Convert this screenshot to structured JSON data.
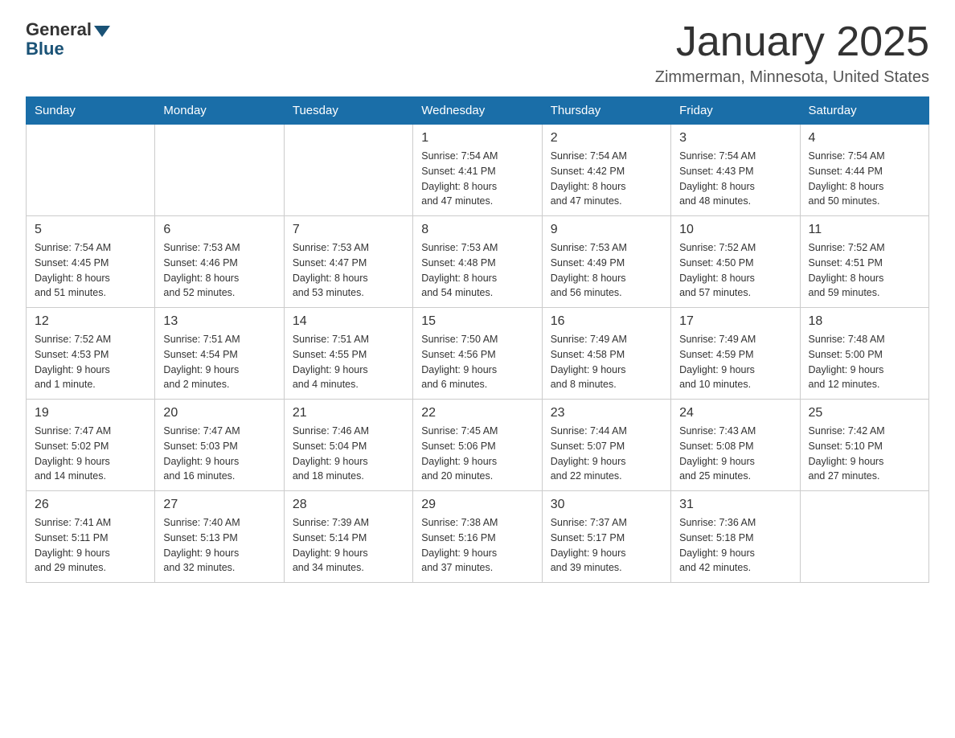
{
  "logo": {
    "text_general": "General",
    "text_blue": "Blue"
  },
  "title": "January 2025",
  "subtitle": "Zimmerman, Minnesota, United States",
  "days_of_week": [
    "Sunday",
    "Monday",
    "Tuesday",
    "Wednesday",
    "Thursday",
    "Friday",
    "Saturday"
  ],
  "weeks": [
    [
      {
        "day": "",
        "info": ""
      },
      {
        "day": "",
        "info": ""
      },
      {
        "day": "",
        "info": ""
      },
      {
        "day": "1",
        "info": "Sunrise: 7:54 AM\nSunset: 4:41 PM\nDaylight: 8 hours\nand 47 minutes."
      },
      {
        "day": "2",
        "info": "Sunrise: 7:54 AM\nSunset: 4:42 PM\nDaylight: 8 hours\nand 47 minutes."
      },
      {
        "day": "3",
        "info": "Sunrise: 7:54 AM\nSunset: 4:43 PM\nDaylight: 8 hours\nand 48 minutes."
      },
      {
        "day": "4",
        "info": "Sunrise: 7:54 AM\nSunset: 4:44 PM\nDaylight: 8 hours\nand 50 minutes."
      }
    ],
    [
      {
        "day": "5",
        "info": "Sunrise: 7:54 AM\nSunset: 4:45 PM\nDaylight: 8 hours\nand 51 minutes."
      },
      {
        "day": "6",
        "info": "Sunrise: 7:53 AM\nSunset: 4:46 PM\nDaylight: 8 hours\nand 52 minutes."
      },
      {
        "day": "7",
        "info": "Sunrise: 7:53 AM\nSunset: 4:47 PM\nDaylight: 8 hours\nand 53 minutes."
      },
      {
        "day": "8",
        "info": "Sunrise: 7:53 AM\nSunset: 4:48 PM\nDaylight: 8 hours\nand 54 minutes."
      },
      {
        "day": "9",
        "info": "Sunrise: 7:53 AM\nSunset: 4:49 PM\nDaylight: 8 hours\nand 56 minutes."
      },
      {
        "day": "10",
        "info": "Sunrise: 7:52 AM\nSunset: 4:50 PM\nDaylight: 8 hours\nand 57 minutes."
      },
      {
        "day": "11",
        "info": "Sunrise: 7:52 AM\nSunset: 4:51 PM\nDaylight: 8 hours\nand 59 minutes."
      }
    ],
    [
      {
        "day": "12",
        "info": "Sunrise: 7:52 AM\nSunset: 4:53 PM\nDaylight: 9 hours\nand 1 minute."
      },
      {
        "day": "13",
        "info": "Sunrise: 7:51 AM\nSunset: 4:54 PM\nDaylight: 9 hours\nand 2 minutes."
      },
      {
        "day": "14",
        "info": "Sunrise: 7:51 AM\nSunset: 4:55 PM\nDaylight: 9 hours\nand 4 minutes."
      },
      {
        "day": "15",
        "info": "Sunrise: 7:50 AM\nSunset: 4:56 PM\nDaylight: 9 hours\nand 6 minutes."
      },
      {
        "day": "16",
        "info": "Sunrise: 7:49 AM\nSunset: 4:58 PM\nDaylight: 9 hours\nand 8 minutes."
      },
      {
        "day": "17",
        "info": "Sunrise: 7:49 AM\nSunset: 4:59 PM\nDaylight: 9 hours\nand 10 minutes."
      },
      {
        "day": "18",
        "info": "Sunrise: 7:48 AM\nSunset: 5:00 PM\nDaylight: 9 hours\nand 12 minutes."
      }
    ],
    [
      {
        "day": "19",
        "info": "Sunrise: 7:47 AM\nSunset: 5:02 PM\nDaylight: 9 hours\nand 14 minutes."
      },
      {
        "day": "20",
        "info": "Sunrise: 7:47 AM\nSunset: 5:03 PM\nDaylight: 9 hours\nand 16 minutes."
      },
      {
        "day": "21",
        "info": "Sunrise: 7:46 AM\nSunset: 5:04 PM\nDaylight: 9 hours\nand 18 minutes."
      },
      {
        "day": "22",
        "info": "Sunrise: 7:45 AM\nSunset: 5:06 PM\nDaylight: 9 hours\nand 20 minutes."
      },
      {
        "day": "23",
        "info": "Sunrise: 7:44 AM\nSunset: 5:07 PM\nDaylight: 9 hours\nand 22 minutes."
      },
      {
        "day": "24",
        "info": "Sunrise: 7:43 AM\nSunset: 5:08 PM\nDaylight: 9 hours\nand 25 minutes."
      },
      {
        "day": "25",
        "info": "Sunrise: 7:42 AM\nSunset: 5:10 PM\nDaylight: 9 hours\nand 27 minutes."
      }
    ],
    [
      {
        "day": "26",
        "info": "Sunrise: 7:41 AM\nSunset: 5:11 PM\nDaylight: 9 hours\nand 29 minutes."
      },
      {
        "day": "27",
        "info": "Sunrise: 7:40 AM\nSunset: 5:13 PM\nDaylight: 9 hours\nand 32 minutes."
      },
      {
        "day": "28",
        "info": "Sunrise: 7:39 AM\nSunset: 5:14 PM\nDaylight: 9 hours\nand 34 minutes."
      },
      {
        "day": "29",
        "info": "Sunrise: 7:38 AM\nSunset: 5:16 PM\nDaylight: 9 hours\nand 37 minutes."
      },
      {
        "day": "30",
        "info": "Sunrise: 7:37 AM\nSunset: 5:17 PM\nDaylight: 9 hours\nand 39 minutes."
      },
      {
        "day": "31",
        "info": "Sunrise: 7:36 AM\nSunset: 5:18 PM\nDaylight: 9 hours\nand 42 minutes."
      },
      {
        "day": "",
        "info": ""
      }
    ]
  ]
}
